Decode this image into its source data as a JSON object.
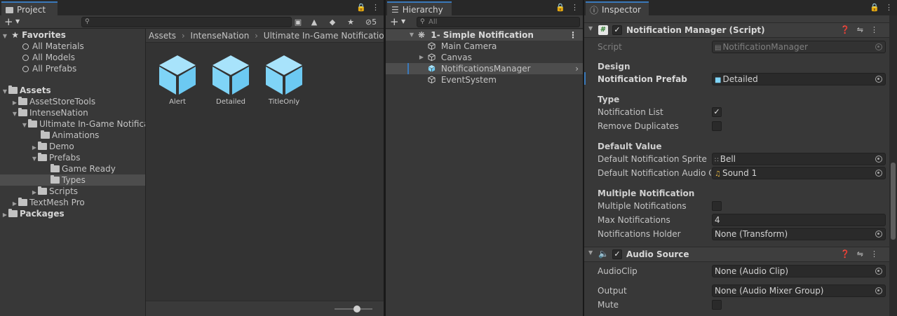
{
  "project": {
    "tab_label": "Project",
    "hidden_count": "5",
    "breadcrumb": [
      "Assets",
      "IntenseNation",
      "Ultimate In-Game Notifications"
    ],
    "favorites": {
      "label": "Favorites",
      "items": [
        "All Materials",
        "All Models",
        "All Prefabs"
      ]
    },
    "tree": [
      {
        "label": "Assets"
      },
      {
        "label": "AssetStoreTools"
      },
      {
        "label": "IntenseNation"
      },
      {
        "label": "Ultimate In-Game Notifica"
      },
      {
        "label": "Animations"
      },
      {
        "label": "Demo"
      },
      {
        "label": "Prefabs"
      },
      {
        "label": "Game Ready"
      },
      {
        "label": "Types"
      },
      {
        "label": "Scripts"
      },
      {
        "label": "TextMesh Pro"
      },
      {
        "label": "Packages"
      }
    ],
    "prefabs": [
      "Alert",
      "Detailed",
      "TitleOnly"
    ],
    "icon_color": "#7fd4f7"
  },
  "hierarchy": {
    "tab_label": "Hierarchy",
    "search_placeholder": "All",
    "scene": "1- Simple Notification",
    "objects": [
      "Main Camera",
      "Canvas",
      "NotificationsManager",
      "EventSystem"
    ]
  },
  "inspector": {
    "tab_label": "Inspector",
    "notification_manager": {
      "title": "Notification Manager (Script)",
      "script_label": "Script",
      "script_value": "NotificationManager",
      "design_header": "Design",
      "prefab_label": "Notification Prefab",
      "prefab_value": "Detailed",
      "type_header": "Type",
      "list_label": "Notification List",
      "remove_dup_label": "Remove Duplicates",
      "default_header": "Default Value",
      "sprite_label": "Default Notification Sprite",
      "sprite_value": "Bell",
      "audio_label": "Default Notification Audio Cli",
      "audio_value": "Sound 1",
      "multiple_header": "Multiple Notification",
      "multiple_label": "Multiple Notifications",
      "max_label": "Max Notifications",
      "max_value": "4",
      "holder_label": "Notifications Holder",
      "holder_value": "None (Transform)"
    },
    "audio_source": {
      "title": "Audio Source",
      "clip_label": "AudioClip",
      "clip_value": "None (Audio Clip)",
      "output_label": "Output",
      "output_value": "None (Audio Mixer Group)",
      "mute_label": "Mute"
    }
  }
}
